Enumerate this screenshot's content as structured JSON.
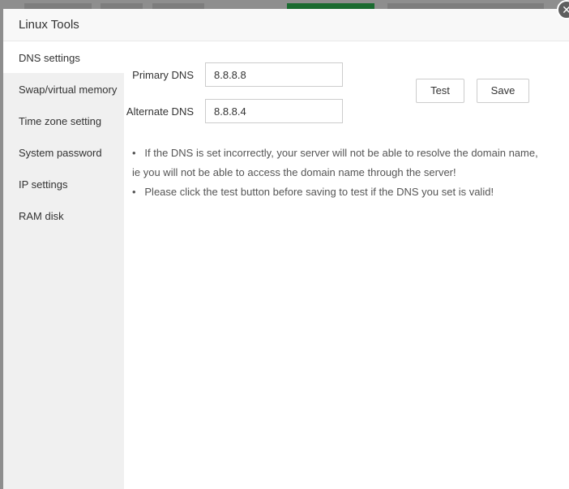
{
  "dialog": {
    "title": "Linux Tools",
    "close_icon": "close-icon"
  },
  "sidebar": {
    "items": [
      {
        "label": "DNS settings",
        "active": true
      },
      {
        "label": "Swap/virtual memory"
      },
      {
        "label": "Time zone setting"
      },
      {
        "label": "System password"
      },
      {
        "label": "IP settings"
      },
      {
        "label": "RAM disk"
      }
    ]
  },
  "dns": {
    "primary_label": "Primary DNS",
    "primary_value": "8.8.8.8",
    "alternate_label": "Alternate DNS",
    "alternate_value": "8.8.8.4",
    "test_label": "Test",
    "save_label": "Save",
    "tips": [
      "If the DNS is set incorrectly, your server will not be able to resolve the domain name,",
      "ie you will not be able to access the domain name through the server!",
      "Please click the test button before saving to test if the DNS you set is valid!"
    ]
  },
  "colors": {
    "backdrop": "#8e8e8e",
    "sidebar": "#f0f0f0",
    "header": "#f8f8f8",
    "bg_tab_active": "#1a6b30"
  }
}
